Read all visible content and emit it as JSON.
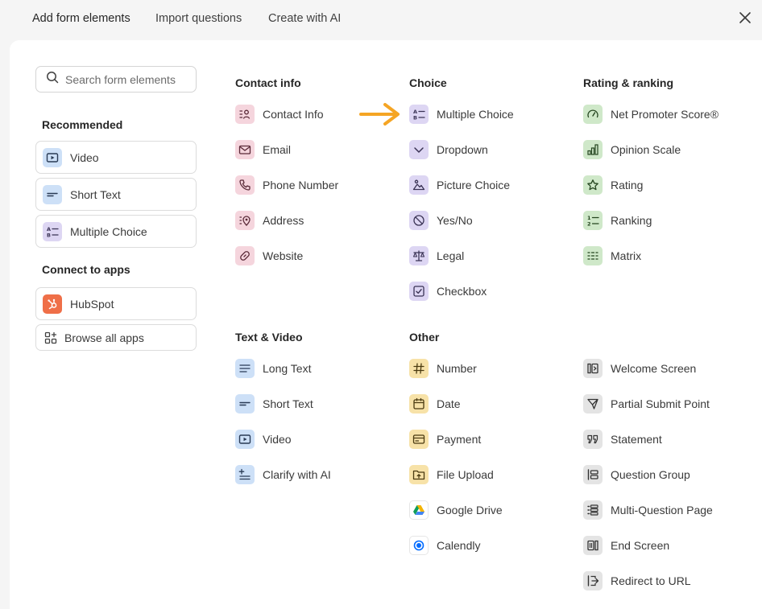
{
  "tabs": [
    {
      "label": "Add form elements"
    },
    {
      "label": "Import questions"
    },
    {
      "label": "Create with AI"
    }
  ],
  "search": {
    "placeholder": "Search form elements"
  },
  "sidebar": {
    "recommended_title": "Recommended",
    "recommended": [
      {
        "label": "Video",
        "icon": "video-icon"
      },
      {
        "label": "Short Text",
        "icon": "short-text-icon"
      },
      {
        "label": "Multiple Choice",
        "icon": "multiple-choice-icon"
      }
    ],
    "apps_title": "Connect to apps",
    "apps": [
      {
        "label": "HubSpot",
        "icon": "hubspot-icon"
      },
      {
        "label": "Browse all apps",
        "icon": "apps-grid-icon"
      }
    ]
  },
  "groups": {
    "contact": {
      "title": "Contact info",
      "items": [
        {
          "label": "Contact Info"
        },
        {
          "label": "Email"
        },
        {
          "label": "Phone Number"
        },
        {
          "label": "Address"
        },
        {
          "label": "Website"
        }
      ]
    },
    "choice": {
      "title": "Choice",
      "items": [
        {
          "label": "Multiple Choice"
        },
        {
          "label": "Dropdown"
        },
        {
          "label": "Picture Choice"
        },
        {
          "label": "Yes/No"
        },
        {
          "label": "Legal"
        },
        {
          "label": "Checkbox"
        }
      ]
    },
    "rating": {
      "title": "Rating & ranking",
      "items": [
        {
          "label": "Net Promoter Score®"
        },
        {
          "label": "Opinion Scale"
        },
        {
          "label": "Rating"
        },
        {
          "label": "Ranking"
        },
        {
          "label": "Matrix"
        }
      ]
    },
    "text_video": {
      "title": "Text & Video",
      "items": [
        {
          "label": "Long Text"
        },
        {
          "label": "Short Text"
        },
        {
          "label": "Video"
        },
        {
          "label": "Clarify with AI"
        }
      ]
    },
    "other": {
      "title": "Other",
      "items": [
        {
          "label": "Number"
        },
        {
          "label": "Date"
        },
        {
          "label": "Payment"
        },
        {
          "label": "File Upload"
        },
        {
          "label": "Google Drive"
        },
        {
          "label": "Calendly"
        }
      ]
    },
    "structure": {
      "items": [
        {
          "label": "Welcome Screen"
        },
        {
          "label": "Partial Submit Point"
        },
        {
          "label": "Statement"
        },
        {
          "label": "Question Group"
        },
        {
          "label": "Multi-Question Page"
        },
        {
          "label": "End Screen"
        },
        {
          "label": "Redirect to URL"
        }
      ]
    }
  },
  "colors": {
    "contact": "#f5d5dd",
    "choice": "#ddd6f3",
    "rating": "#cfe8c9",
    "text_video": "#cde0f7",
    "other": "#f7e2a8",
    "structure": "#e4e4e4",
    "arrow": "#f5a524",
    "hubspot": "#ef6f48"
  }
}
